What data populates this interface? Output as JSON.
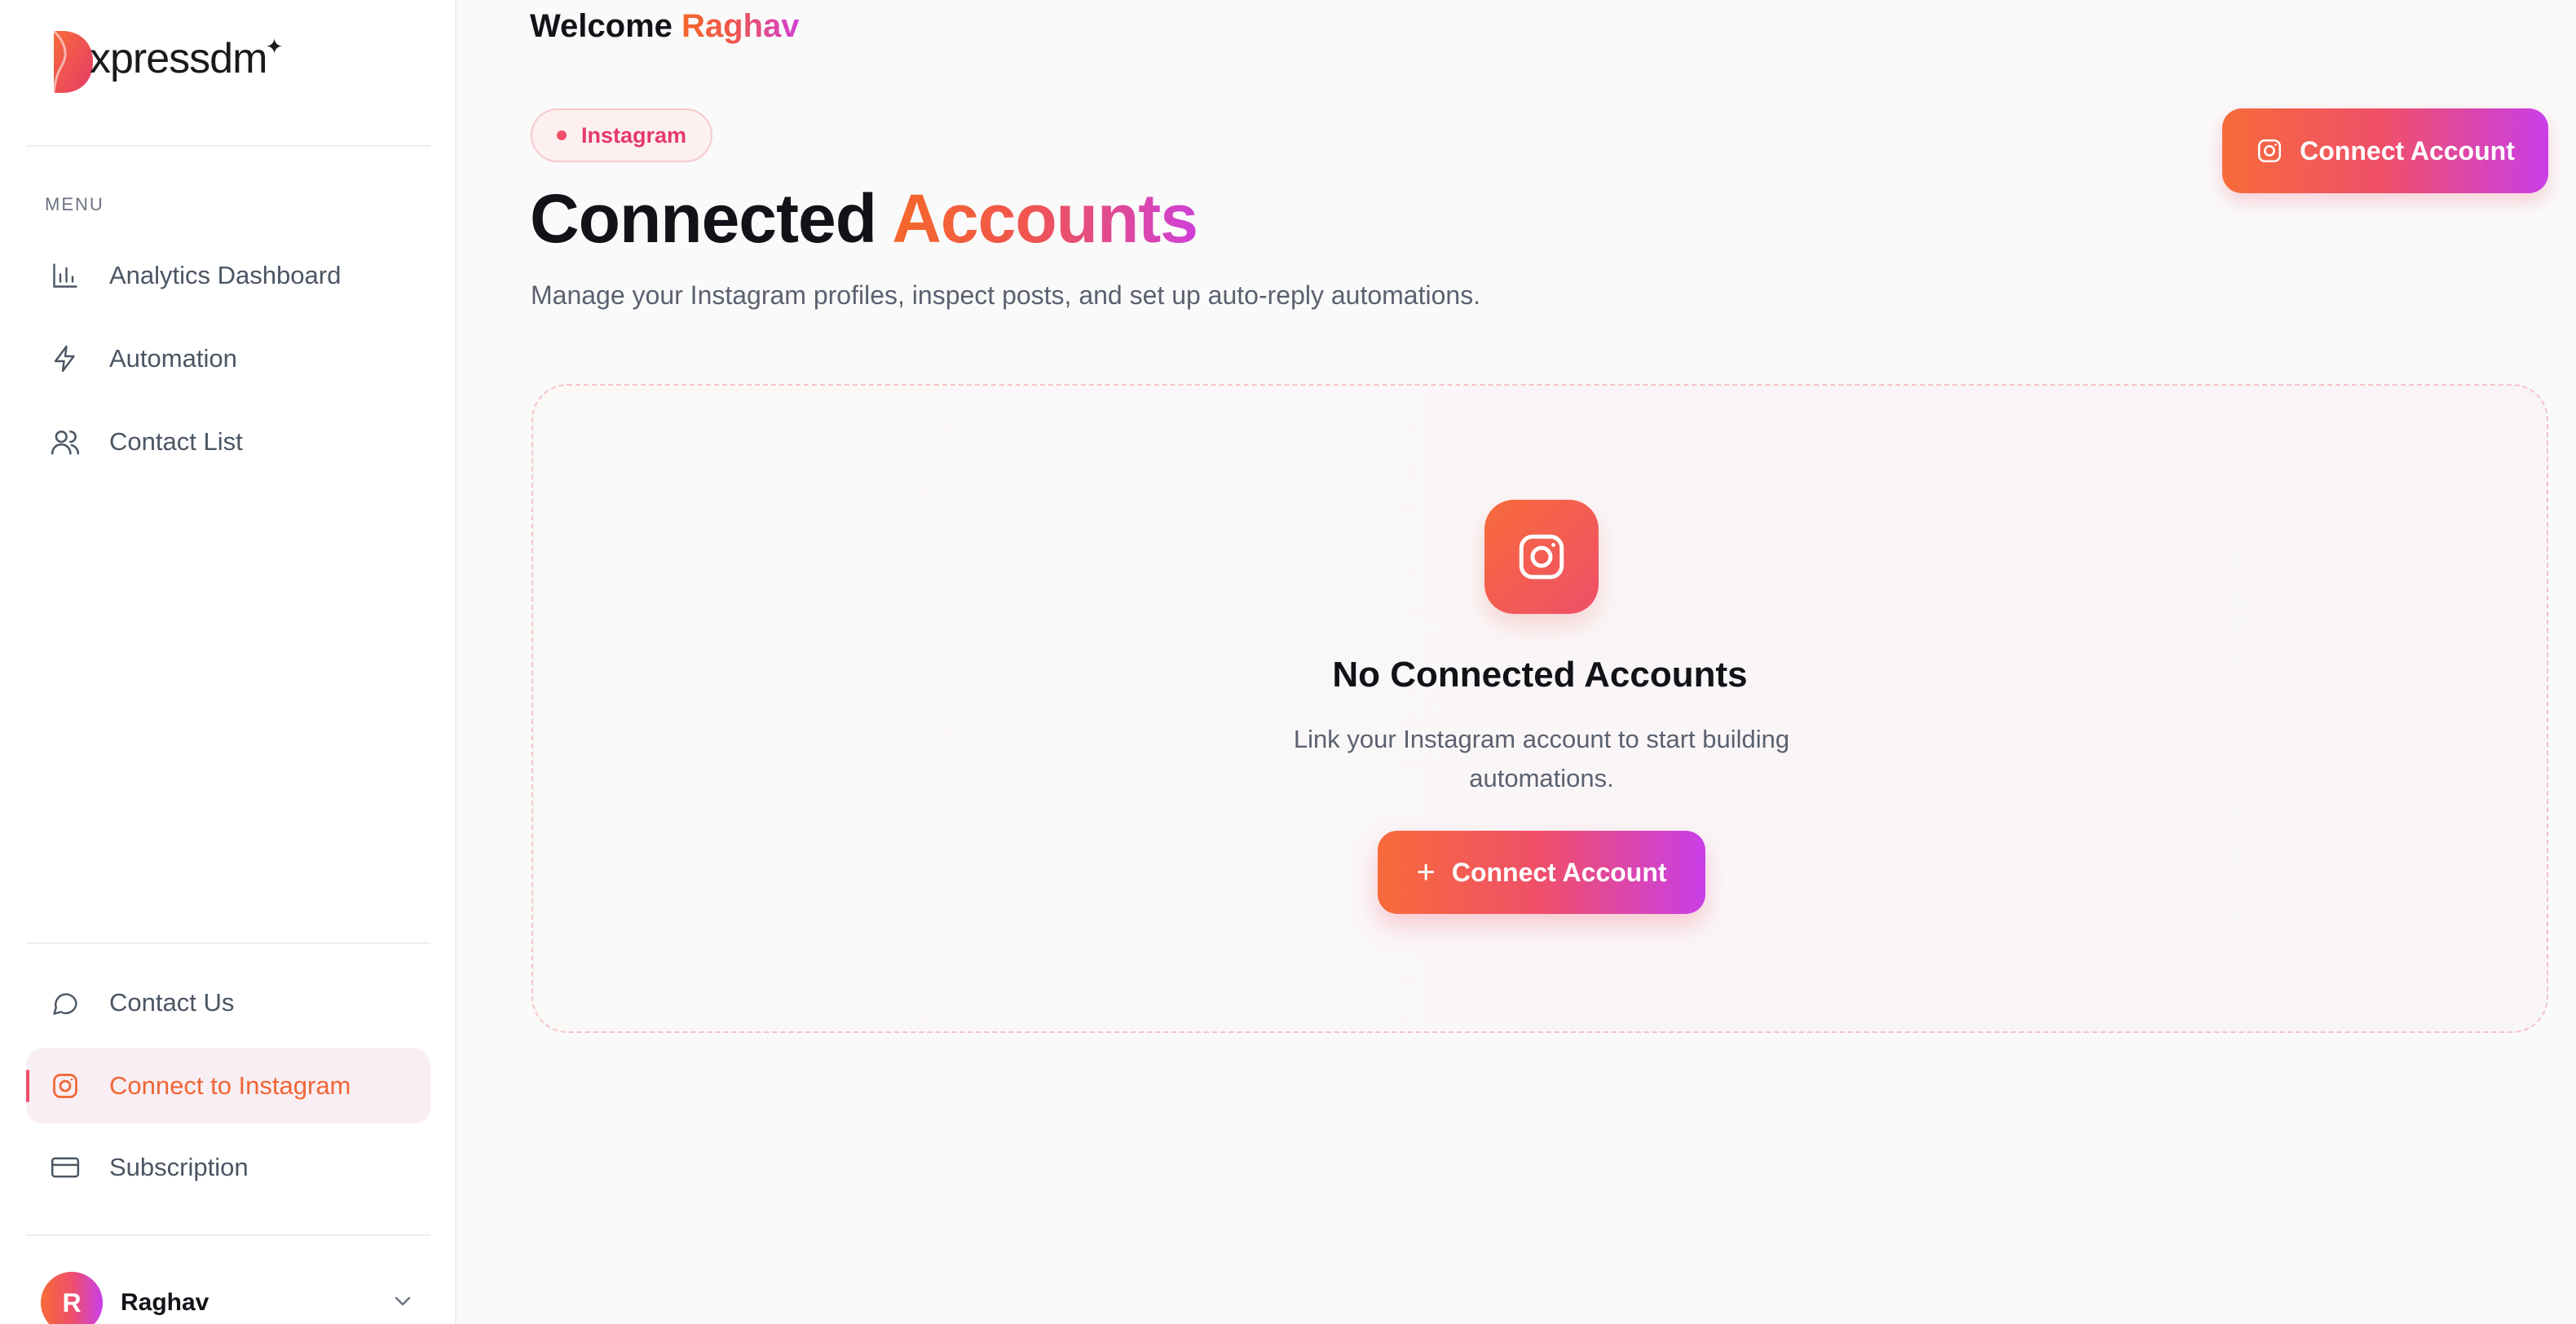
{
  "brand": {
    "name": "xpressdm",
    "colors": {
      "accent_start": "#f76b3a",
      "accent_mid": "#ef4f6a",
      "accent_end": "#c93ee8"
    }
  },
  "sidebar": {
    "menu_label": "MENU",
    "items": [
      {
        "label": "Analytics Dashboard",
        "icon": "bar-chart-icon"
      },
      {
        "label": "Automation",
        "icon": "lightning-icon"
      },
      {
        "label": "Contact List",
        "icon": "users-icon"
      }
    ],
    "bottom_items": [
      {
        "label": "Contact Us",
        "icon": "chat-bubble-icon"
      },
      {
        "label": "Connect to Instagram",
        "icon": "instagram-icon",
        "active": true
      },
      {
        "label": "Subscription",
        "icon": "credit-card-icon"
      }
    ],
    "user": {
      "initial": "R",
      "name": "Raghav"
    }
  },
  "header": {
    "welcome": "Welcome",
    "user_name": "Raghav"
  },
  "main": {
    "badge": "Instagram",
    "title_part1": "Connected",
    "title_part2": "Accounts",
    "subtitle": "Manage your Instagram profiles, inspect posts, and set up auto-reply automations.",
    "connect_button": "Connect Account",
    "empty_state": {
      "title": "No Connected Accounts",
      "description": "Link your Instagram account to start building automations.",
      "button": "Connect Account"
    }
  }
}
